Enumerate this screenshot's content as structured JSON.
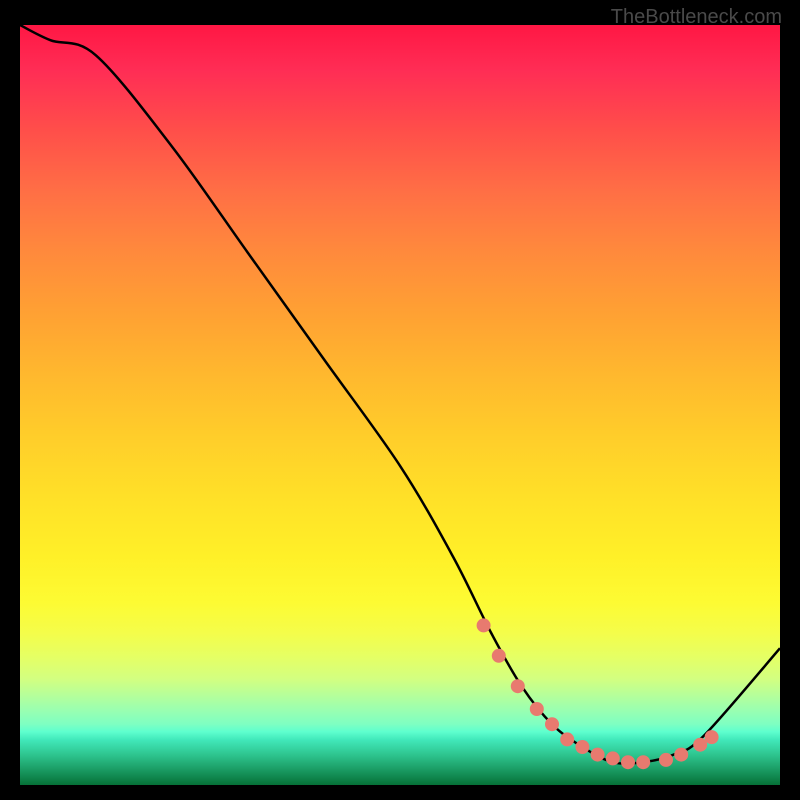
{
  "watermark": "TheBottleneck.com",
  "chart_data": {
    "type": "line",
    "title": "",
    "xlabel": "",
    "ylabel": "",
    "xlim": [
      0,
      100
    ],
    "ylim": [
      0,
      100
    ],
    "series": [
      {
        "name": "curve",
        "x": [
          0,
          4,
          10,
          20,
          30,
          40,
          50,
          57,
          62,
          66,
          70,
          74,
          78,
          82,
          86,
          90,
          100
        ],
        "values": [
          100,
          98,
          96,
          84,
          70,
          56,
          42,
          30,
          20,
          13,
          8,
          5,
          3,
          3,
          4,
          6.5,
          18
        ]
      }
    ],
    "markers": {
      "name": "dotted-segment",
      "color": "#e87a6f",
      "x": [
        61,
        63,
        65.5,
        68,
        70,
        72,
        74,
        76,
        78,
        80,
        82,
        85,
        87,
        89.5,
        91
      ],
      "values": [
        21,
        17,
        13,
        10,
        8,
        6,
        5,
        4,
        3.5,
        3,
        3,
        3.3,
        4,
        5.3,
        6.3
      ]
    },
    "gradient_stops": [
      {
        "pct": 0,
        "color": "#ff1744"
      },
      {
        "pct": 14,
        "color": "#ff4f4a"
      },
      {
        "pct": 30,
        "color": "#ff8a3c"
      },
      {
        "pct": 46,
        "color": "#ffb82e"
      },
      {
        "pct": 62,
        "color": "#ffe028"
      },
      {
        "pct": 76,
        "color": "#fdfb33"
      },
      {
        "pct": 86,
        "color": "#d3ff80"
      },
      {
        "pct": 92,
        "color": "#7effc2"
      },
      {
        "pct": 96,
        "color": "#2ec58f"
      },
      {
        "pct": 100,
        "color": "#067137"
      }
    ]
  }
}
